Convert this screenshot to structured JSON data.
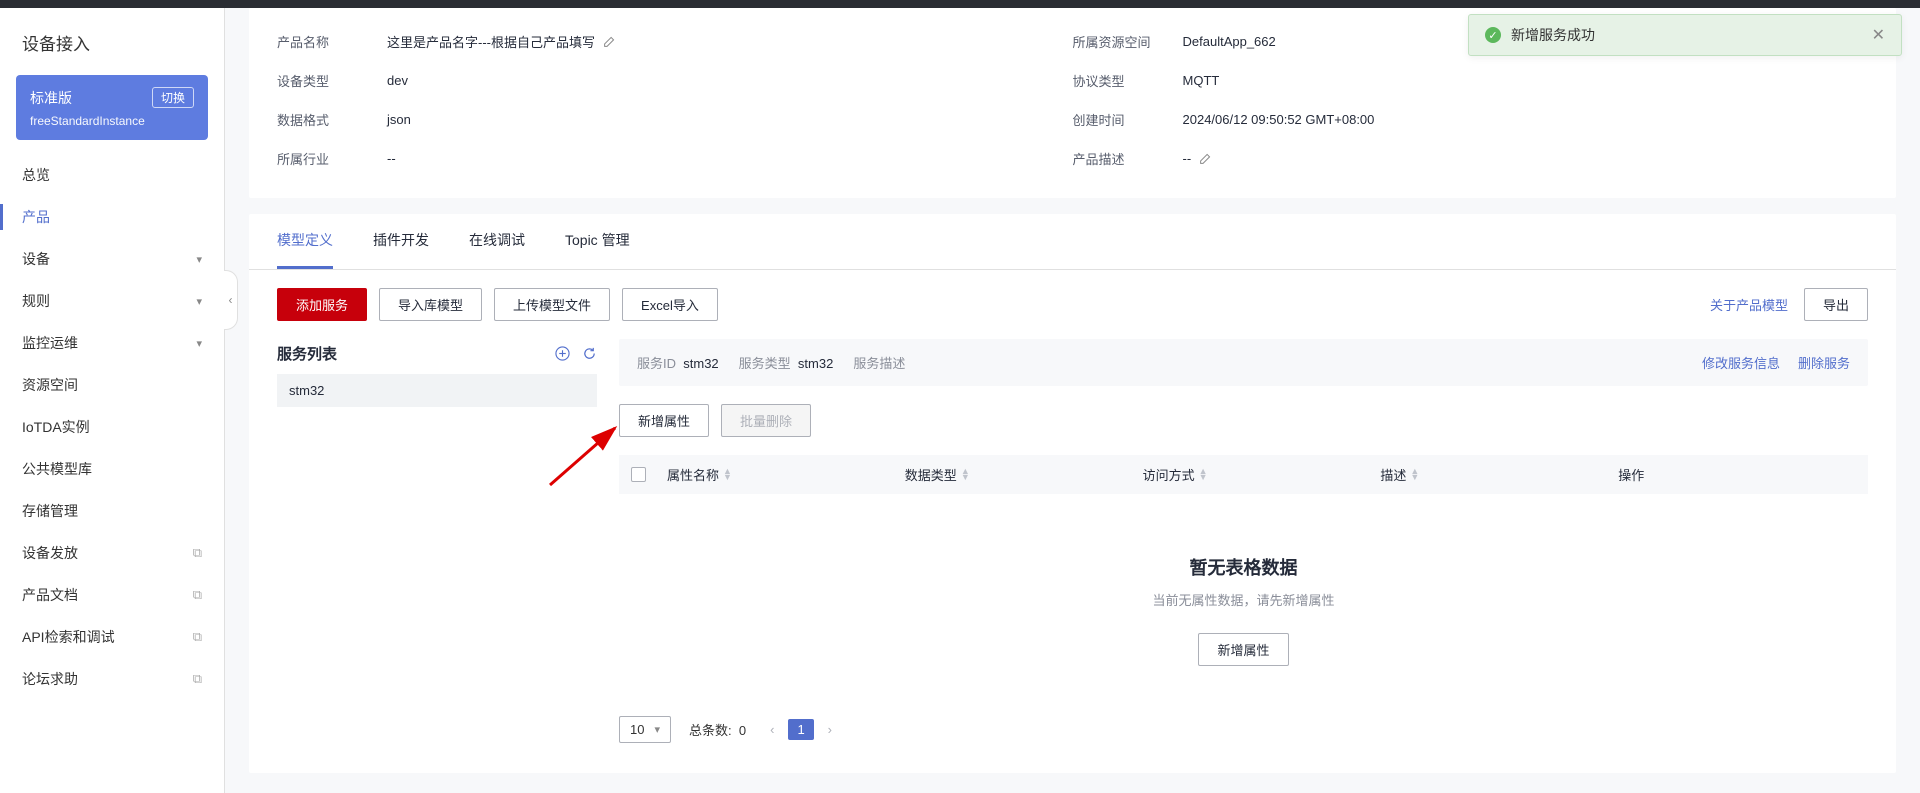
{
  "toast": {
    "message": "新增服务成功"
  },
  "sidebar": {
    "title": "设备接入",
    "instance": {
      "type": "标准版",
      "switchLabel": "切换",
      "name": "freeStandardInstance"
    },
    "nav": [
      {
        "label": "总览",
        "expandable": false,
        "external": false
      },
      {
        "label": "产品",
        "expandable": false,
        "external": false,
        "active": true
      },
      {
        "label": "设备",
        "expandable": true,
        "external": false
      },
      {
        "label": "规则",
        "expandable": true,
        "external": false
      },
      {
        "label": "监控运维",
        "expandable": true,
        "external": false
      },
      {
        "label": "资源空间",
        "expandable": false,
        "external": false
      },
      {
        "label": "IoTDA实例",
        "expandable": false,
        "external": false
      },
      {
        "label": "公共模型库",
        "expandable": false,
        "external": false
      },
      {
        "label": "存储管理",
        "expandable": false,
        "external": false
      },
      {
        "label": "设备发放",
        "expandable": false,
        "external": true
      },
      {
        "label": "产品文档",
        "expandable": false,
        "external": true
      },
      {
        "label": "API检索和调试",
        "expandable": false,
        "external": true
      },
      {
        "label": "论坛求助",
        "expandable": false,
        "external": true
      }
    ]
  },
  "info": {
    "left": [
      {
        "label": "产品名称",
        "value": "这里是产品名字---根据自己产品填写",
        "editable": true
      },
      {
        "label": "设备类型",
        "value": "dev"
      },
      {
        "label": "数据格式",
        "value": "json"
      },
      {
        "label": "所属行业",
        "value": "--"
      }
    ],
    "right": [
      {
        "label": "所属资源空间",
        "value": "DefaultApp_662"
      },
      {
        "label": "协议类型",
        "value": "MQTT"
      },
      {
        "label": "创建时间",
        "value": "2024/06/12 09:50:52 GMT+08:00"
      },
      {
        "label": "产品描述",
        "value": "--",
        "editable": true
      }
    ]
  },
  "tabs": {
    "items": [
      "模型定义",
      "插件开发",
      "在线调试",
      "Topic 管理"
    ],
    "active": 0
  },
  "toolbar": {
    "addService": "添加服务",
    "importLib": "导入库模型",
    "uploadModel": "上传模型文件",
    "excelImport": "Excel导入",
    "aboutModel": "关于产品模型",
    "export": "导出"
  },
  "serviceList": {
    "title": "服务列表",
    "items": [
      "stm32"
    ]
  },
  "serviceDetail": {
    "fields": {
      "idLabel": "服务ID",
      "idValue": "stm32",
      "typeLabel": "服务类型",
      "typeValue": "stm32",
      "descLabel": "服务描述",
      "descValue": ""
    },
    "actions": {
      "modify": "修改服务信息",
      "delete": "删除服务"
    },
    "attrToolbar": {
      "add": "新增属性",
      "batchDelete": "批量删除"
    },
    "columns": [
      "属性名称",
      "数据类型",
      "访问方式",
      "描述",
      "操作"
    ],
    "empty": {
      "title": "暂无表格数据",
      "desc": "当前无属性数据，请先新增属性",
      "btn": "新增属性"
    },
    "pagination": {
      "size": "10",
      "totalLabel": "总条数:",
      "total": "0",
      "page": "1"
    }
  }
}
